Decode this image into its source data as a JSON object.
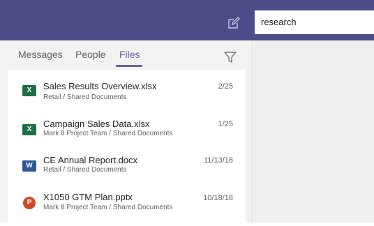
{
  "header": {
    "search_value": "research",
    "compose_icon": "compose-icon"
  },
  "tabs": [
    {
      "label": "Messages",
      "active": false
    },
    {
      "label": "People",
      "active": false
    },
    {
      "label": "Files",
      "active": true
    }
  ],
  "filter_icon": "filter-icon",
  "files": [
    {
      "name": "Sales Results Overview.xlsx",
      "path": "Retail / Shared Documents",
      "date": "2/25",
      "type": "excel",
      "icon_color": "#1d7044"
    },
    {
      "name": "Campaign Sales Data.xlsx",
      "path": "Mark 8 Project Team / Shared Documents",
      "date": "1/25",
      "type": "excel",
      "icon_color": "#1d7044"
    },
    {
      "name": "CE Annual Report.docx",
      "path": "Retail / Shared Documents",
      "date": "11/13/18",
      "type": "word",
      "icon_color": "#2b579a"
    },
    {
      "name": "X1050 GTM Plan.pptx",
      "path": "Mark 8 Project Team / Shared Documents",
      "date": "10/18/18",
      "type": "powerpoint",
      "icon_color": "#d24726"
    }
  ],
  "colors": {
    "header_bg": "#4b4c88",
    "accent": "#6264a7"
  }
}
